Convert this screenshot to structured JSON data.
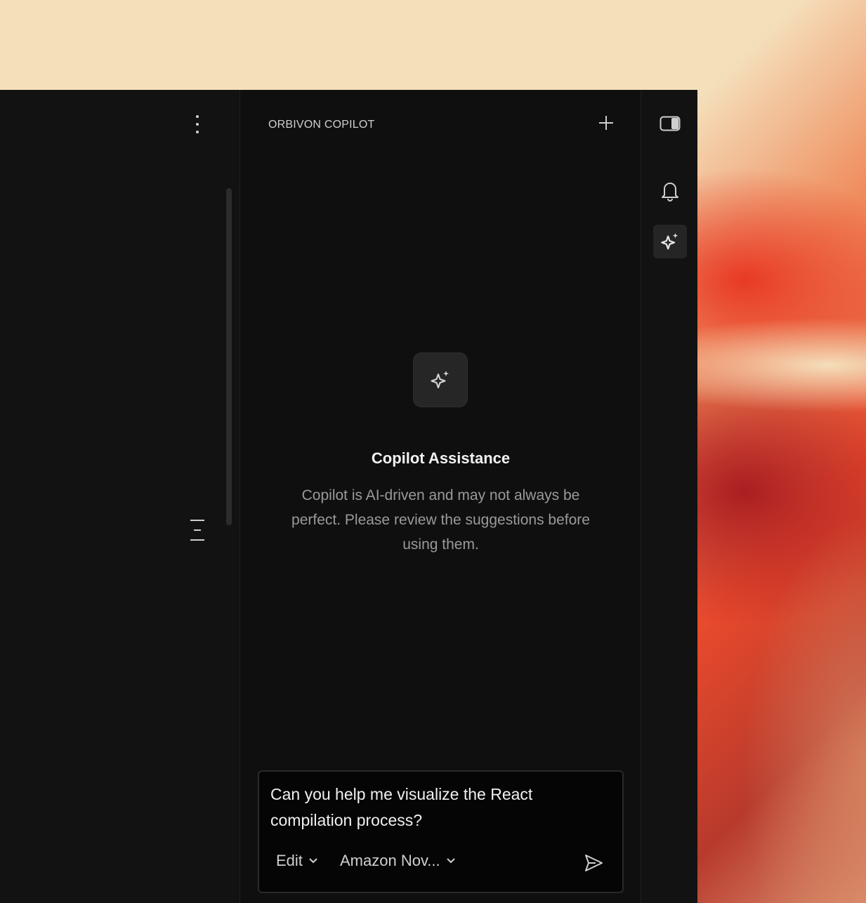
{
  "left_pane": {
    "more_icon": "vertical-dots-icon",
    "outline_icon": "outline-lines-icon"
  },
  "copilot": {
    "title": "ORBIVON COPILOT",
    "new_chat_icon": "plus-icon",
    "hero": {
      "icon": "sparkle-icon",
      "title": "Copilot Assistance",
      "description": "Copilot is AI-driven and may not always be perfect. Please review the suggestions before using them."
    },
    "composer": {
      "input_value": "Can you help me visualize the React compilation process?",
      "mode_label": "Edit",
      "model_label": "Amazon Nov...",
      "send_icon": "send-icon"
    }
  },
  "rail": {
    "items": [
      {
        "icon": "panel-toggle-icon"
      },
      {
        "icon": "bell-icon"
      },
      {
        "icon": "sparkle-icon",
        "active": true
      }
    ]
  },
  "colors": {
    "window_bg": "#111111",
    "text_primary": "#f2f2f2",
    "text_muted": "#9a9a9a"
  }
}
